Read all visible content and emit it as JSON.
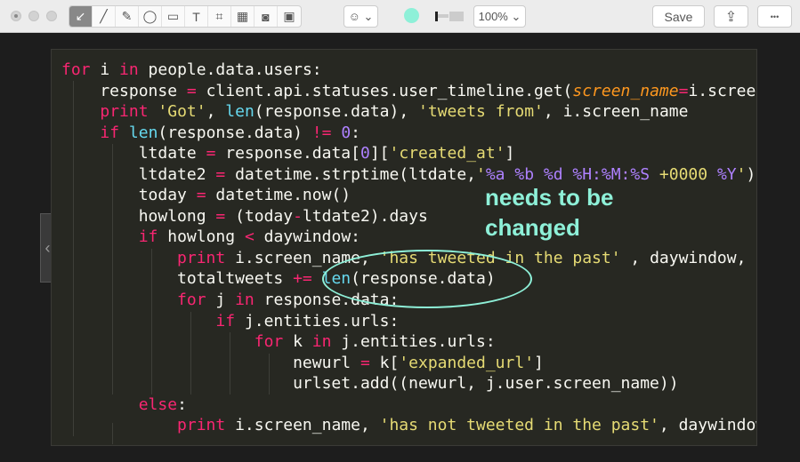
{
  "toolbar": {
    "tools": [
      {
        "name": "arrow-tool",
        "glyph": "↙"
      },
      {
        "name": "line-tool",
        "glyph": "╱"
      },
      {
        "name": "pen-tool",
        "glyph": "✎"
      },
      {
        "name": "ellipse-tool",
        "glyph": "◯"
      },
      {
        "name": "rectangle-tool",
        "glyph": "▭"
      },
      {
        "name": "text-tool",
        "glyph": "T"
      },
      {
        "name": "crop-tool",
        "glyph": "⌗"
      },
      {
        "name": "pixelate-tool",
        "glyph": "▦"
      },
      {
        "name": "spotlight-tool",
        "glyph": "◙"
      },
      {
        "name": "highlight-tool",
        "glyph": "▣"
      }
    ],
    "emoji_glyph": "☺ ⌄",
    "color": "#8ef0d8",
    "zoom": "100% ⌄",
    "save": "Save",
    "share_glyph": "⇪",
    "more_glyph": "•••"
  },
  "code": [
    [
      [
        "k",
        "for"
      ],
      [
        "t",
        " i "
      ],
      [
        "k",
        "in"
      ],
      [
        "t",
        " people.data.users:"
      ]
    ],
    [
      [
        "t",
        "    response "
      ],
      [
        "k",
        "="
      ],
      [
        "t",
        " client.api.statuses.user_timeline.get("
      ],
      [
        "p",
        "screen_name"
      ],
      [
        "k",
        "="
      ],
      [
        "t",
        "i.screen_name"
      ]
    ],
    [
      [
        "t",
        "    "
      ],
      [
        "k",
        "print"
      ],
      [
        "t",
        " "
      ],
      [
        "s",
        "'Got'"
      ],
      [
        "t",
        ", "
      ],
      [
        "b",
        "len"
      ],
      [
        "t",
        "(response.data), "
      ],
      [
        "s",
        "'tweets from'"
      ],
      [
        "t",
        ", i.screen_name"
      ]
    ],
    [
      [
        "t",
        "    "
      ],
      [
        "k",
        "if"
      ],
      [
        "t",
        " "
      ],
      [
        "b",
        "len"
      ],
      [
        "t",
        "(response.data) "
      ],
      [
        "k",
        "!="
      ],
      [
        "t",
        " "
      ],
      [
        "n",
        "0"
      ],
      [
        "t",
        ":"
      ]
    ],
    [
      [
        "t",
        "        ltdate "
      ],
      [
        "k",
        "="
      ],
      [
        "t",
        " response.data["
      ],
      [
        "n",
        "0"
      ],
      [
        "t",
        "]["
      ],
      [
        "s",
        "'created_at'"
      ],
      [
        "t",
        "]"
      ]
    ],
    [
      [
        "t",
        "        ltdate2 "
      ],
      [
        "k",
        "="
      ],
      [
        "t",
        " datetime.strptime(ltdate,"
      ],
      [
        "s",
        "'"
      ],
      [
        "n",
        "%a %b %d %H:%M:%S"
      ],
      [
        "s",
        " +0000 "
      ],
      [
        "n",
        "%Y"
      ],
      [
        "s",
        "'"
      ],
      [
        "t",
        ")"
      ]
    ],
    [
      [
        "t",
        "        today "
      ],
      [
        "k",
        "="
      ],
      [
        "t",
        " datetime.now()"
      ]
    ],
    [
      [
        "t",
        "        howlong "
      ],
      [
        "k",
        "="
      ],
      [
        "t",
        " (today"
      ],
      [
        "k",
        "-"
      ],
      [
        "t",
        "ltdate2).days"
      ]
    ],
    [
      [
        "t",
        "        "
      ],
      [
        "k",
        "if"
      ],
      [
        "t",
        " howlong "
      ],
      [
        "k",
        "<"
      ],
      [
        "t",
        " daywindow:"
      ]
    ],
    [
      [
        "t",
        "            "
      ],
      [
        "k",
        "print"
      ],
      [
        "t",
        " i.screen_name, "
      ],
      [
        "s",
        "'has tweeted in the past'"
      ],
      [
        "t",
        " , daywindow,"
      ]
    ],
    [
      [
        "t",
        "            totaltweets "
      ],
      [
        "k",
        "+="
      ],
      [
        "t",
        " "
      ],
      [
        "b",
        "len"
      ],
      [
        "t",
        "(response.data)"
      ]
    ],
    [
      [
        "t",
        "            "
      ],
      [
        "k",
        "for"
      ],
      [
        "t",
        " j "
      ],
      [
        "k",
        "in"
      ],
      [
        "t",
        " response.data:"
      ]
    ],
    [
      [
        "t",
        "                "
      ],
      [
        "k",
        "if"
      ],
      [
        "t",
        " j.entities.urls:"
      ]
    ],
    [
      [
        "t",
        "                    "
      ],
      [
        "k",
        "for"
      ],
      [
        "t",
        " k "
      ],
      [
        "k",
        "in"
      ],
      [
        "t",
        " j.entities.urls:"
      ]
    ],
    [
      [
        "t",
        "                        newurl "
      ],
      [
        "k",
        "="
      ],
      [
        "t",
        " k["
      ],
      [
        "s",
        "'expanded_url'"
      ],
      [
        "t",
        "]"
      ]
    ],
    [
      [
        "t",
        "                        urlset.add((newurl, j.user.screen_name))"
      ]
    ],
    [
      [
        "t",
        "        "
      ],
      [
        "k",
        "else"
      ],
      [
        "t",
        ":"
      ]
    ],
    [
      [
        "t",
        "            "
      ],
      [
        "k",
        "print"
      ],
      [
        "t",
        " i.screen_name, "
      ],
      [
        "s",
        "'has not tweeted in the past'"
      ],
      [
        "t",
        ", daywindow"
      ]
    ]
  ],
  "annotation": {
    "text_line1": "needs to be",
    "text_line2": "changed",
    "color": "#8ef0d8"
  },
  "side_handle_glyph": "‹"
}
